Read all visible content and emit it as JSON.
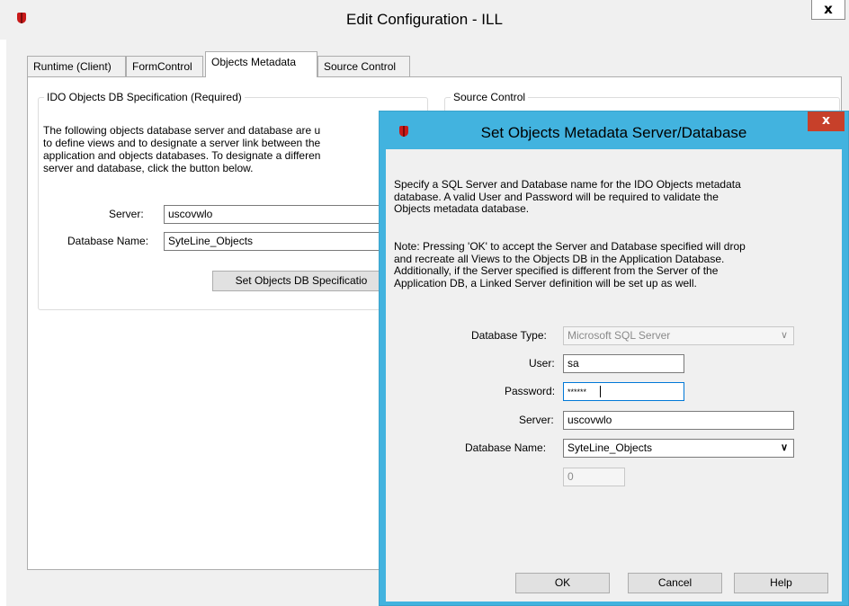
{
  "main_window": {
    "title": "Edit Configuration - ILL",
    "close_glyph": "x",
    "tabs": [
      {
        "label": "Runtime (Client)"
      },
      {
        "label": "FormControl"
      },
      {
        "label": "Objects Metadata"
      },
      {
        "label": "Source Control"
      }
    ],
    "ido_group": {
      "title": "IDO Objects DB Specification (Required)",
      "description_lines": [
        "The following objects database server and database are u",
        "to define views and to designate a server link between the",
        "application and objects databases. To designate a differen",
        "server and database, click the button below."
      ],
      "server_label": "Server:",
      "server_value": "uscovwlo",
      "database_label": "Database Name:",
      "database_value": "SyteLine_Objects",
      "set_button_label": "Set Objects DB Specificatio"
    },
    "source_group": {
      "title": "Source Control"
    }
  },
  "dialog": {
    "title": "Set Objects Metadata Server/Database",
    "close_glyph": "x",
    "intro_lines": [
      "Specify a SQL Server and Database name for the IDO Objects metadata",
      "database.  A valid User and Password will be required to validate the",
      "Objects metadata database."
    ],
    "note_lines": [
      "Note: Pressing 'OK' to accept the Server and Database specified will drop",
      "and recreate all Views to the Objects DB in the Application Database.",
      "Additionally, if the Server specified is different from the Server of the",
      "Application DB, a Linked Server definition will be set up as well."
    ],
    "db_type_label": "Database Type:",
    "db_type_value": "Microsoft SQL Server",
    "user_label": "User:",
    "user_value": "sa",
    "password_label": "Password:",
    "password_value": "******",
    "server_label": "Server:",
    "server_value": "uscovwlo",
    "database_label": "Database Name:",
    "database_value": "SyteLine_Objects",
    "extra_value": "0",
    "ok_label": "OK",
    "cancel_label": "Cancel",
    "help_label": "Help"
  },
  "icons": {
    "app_logo": "red-shield-icon",
    "dropdown": "chevron-down-icon"
  },
  "colors": {
    "dialog_border": "#42b3df",
    "dialog_close": "#c7402a",
    "logo": "#c81a1a"
  }
}
